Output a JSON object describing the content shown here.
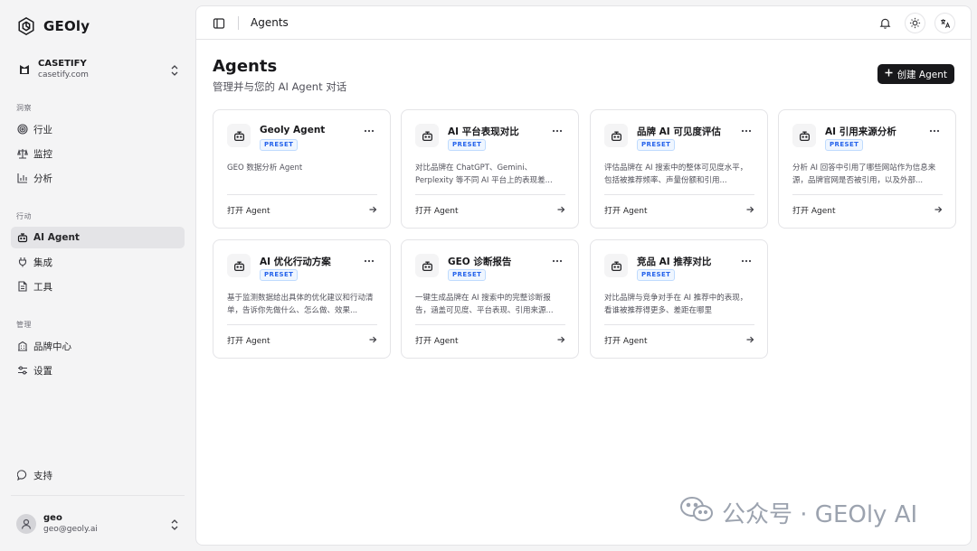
{
  "brand": {
    "name": "GEOly"
  },
  "workspace": {
    "name": "CASETIFY",
    "domain": "casetify.com"
  },
  "sidebar": {
    "sections": [
      {
        "label": "洞察",
        "items": [
          {
            "label": "行业",
            "icon": "target-icon"
          },
          {
            "label": "监控",
            "icon": "scale-icon"
          },
          {
            "label": "分析",
            "icon": "bar-chart-icon"
          }
        ]
      },
      {
        "label": "行动",
        "items": [
          {
            "label": "AI Agent",
            "icon": "bot-icon",
            "active": true
          },
          {
            "label": "集成",
            "icon": "plug-icon"
          },
          {
            "label": "工具",
            "icon": "file-icon"
          }
        ]
      },
      {
        "label": "管理",
        "items": [
          {
            "label": "品牌中心",
            "icon": "building-icon"
          },
          {
            "label": "设置",
            "icon": "sliders-icon"
          }
        ]
      }
    ],
    "support_label": "支持"
  },
  "user": {
    "name": "geo",
    "email": "geo@geoly.ai"
  },
  "topbar": {
    "title": "Agents"
  },
  "page": {
    "title": "Agents",
    "subtitle": "管理并与您的 AI Agent 对话",
    "create_label": "创建 Agent"
  },
  "agents": [
    {
      "name": "Geoly Agent",
      "badge": "PRESET",
      "desc": "GEO 数据分析 Agent",
      "open": "打开 Agent"
    },
    {
      "name": "AI 平台表现对比",
      "badge": "PRESET",
      "desc": "对比品牌在 ChatGPT、Gemini、Perplexity 等不同 AI 平台上的表现差...",
      "open": "打开 Agent"
    },
    {
      "name": "品牌 AI 可见度评估",
      "badge": "PRESET",
      "desc": "评估品牌在 AI 搜索中的整体可见度水平，包括被推荐频率、声量份额和引用...",
      "open": "打开 Agent"
    },
    {
      "name": "AI 引用来源分析",
      "badge": "PRESET",
      "desc": "分析 AI 回答中引用了哪些网站作为信息来源，品牌官网是否被引用，以及外部...",
      "open": "打开 Agent"
    },
    {
      "name": "AI 优化行动方案",
      "badge": "PRESET",
      "desc": "基于监测数据给出具体的优化建议和行动清单，告诉你先做什么、怎么做、效果...",
      "open": "打开 Agent"
    },
    {
      "name": "GEO 诊断报告",
      "badge": "PRESET",
      "desc": "一键生成品牌在 AI 搜索中的完整诊断报告，涵盖可见度、平台表现、引用来源...",
      "open": "打开 Agent"
    },
    {
      "name": "竞品 AI 推荐对比",
      "badge": "PRESET",
      "desc": "对比品牌与竞争对手在 AI 推荐中的表现，看谁被推荐得更多、差距在哪里",
      "open": "打开 Agent"
    }
  ],
  "watermark": {
    "text": "公众号 · GEOly AI"
  }
}
